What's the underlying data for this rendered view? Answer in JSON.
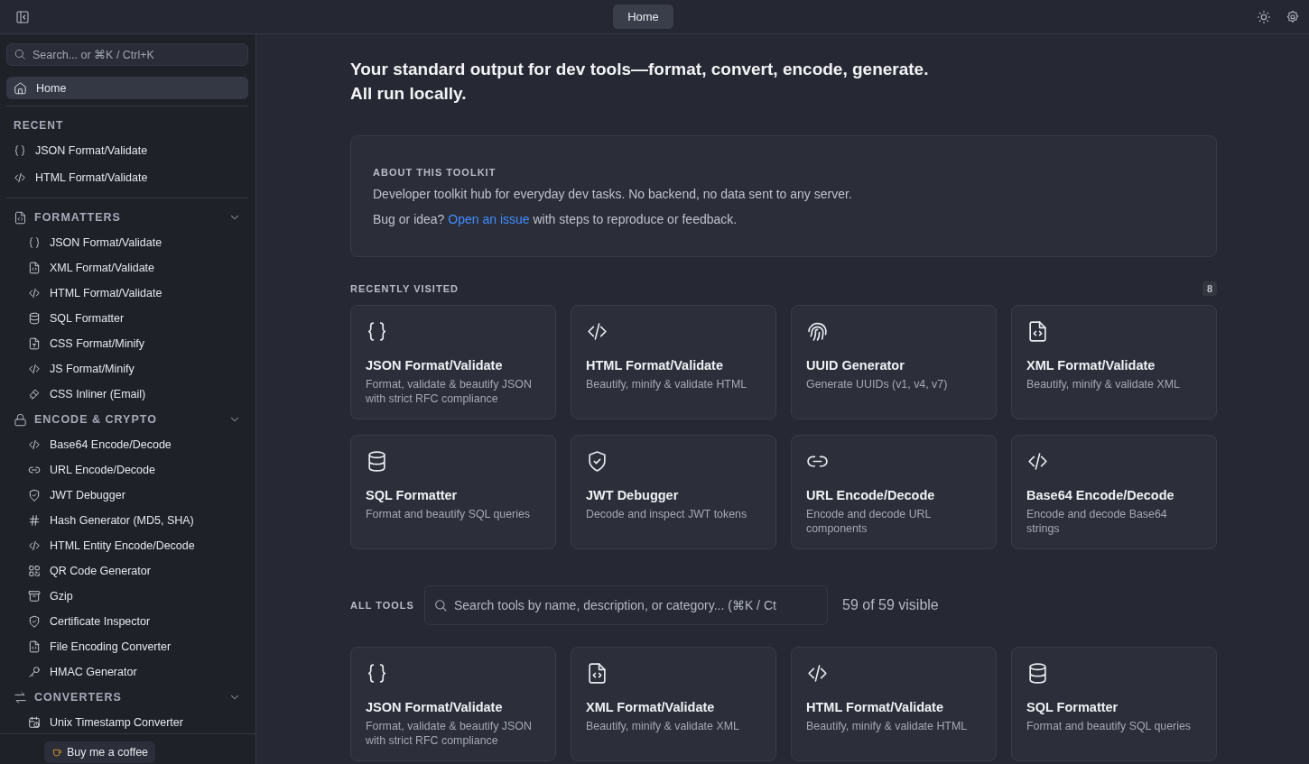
{
  "topbar": {
    "tab": {
      "label": "Home",
      "selected": true
    }
  },
  "sidebar": {
    "search": {
      "placeholder": "Search... or ⌘K / Ctrl+K"
    },
    "home": {
      "label": "Home",
      "selected": true
    },
    "recent": {
      "title": "RECENT",
      "items": [
        {
          "kind": "json",
          "label": "JSON Format/Validate",
          "selected": false
        },
        {
          "kind": "html",
          "label": "HTML Format/Validate",
          "selected": false
        }
      ]
    },
    "sections": [
      {
        "kind": "formatters",
        "title": "FORMATTERS",
        "expanded": true,
        "items": [
          {
            "kind": "json",
            "label": "JSON Format/Validate",
            "selected": false
          },
          {
            "kind": "xml",
            "label": "XML Format/Validate",
            "selected": false
          },
          {
            "kind": "html",
            "label": "HTML Format/Validate",
            "selected": false
          },
          {
            "kind": "sql",
            "label": "SQL Formatter",
            "selected": false
          },
          {
            "kind": "css",
            "label": "CSS Format/Minify",
            "selected": false
          },
          {
            "kind": "js",
            "label": "JS Format/Minify",
            "selected": false
          },
          {
            "kind": "inliner",
            "label": "CSS Inliner (Email)",
            "selected": false
          }
        ]
      },
      {
        "kind": "encode",
        "title": "ENCODE & CRYPTO",
        "expanded": true,
        "items": [
          {
            "kind": "base64",
            "label": "Base64 Encode/Decode",
            "selected": false
          },
          {
            "kind": "url",
            "label": "URL Encode/Decode",
            "selected": false
          },
          {
            "kind": "jwt",
            "label": "JWT Debugger",
            "selected": false
          },
          {
            "kind": "hash",
            "label": "Hash Generator (MD5, SHA)",
            "selected": false
          },
          {
            "kind": "entity",
            "label": "HTML Entity Encode/Decode",
            "selected": false
          },
          {
            "kind": "qr",
            "label": "QR Code Generator",
            "selected": false
          },
          {
            "kind": "gzip",
            "label": "Gzip",
            "selected": false
          },
          {
            "kind": "cert",
            "label": "Certificate Inspector",
            "selected": false
          },
          {
            "kind": "fileenc",
            "label": "File Encoding Converter",
            "selected": false
          },
          {
            "kind": "hmac",
            "label": "HMAC Generator",
            "selected": false
          }
        ]
      },
      {
        "kind": "converters",
        "title": "CONVERTERS",
        "expanded": true,
        "items": [
          {
            "kind": "timestamp",
            "label": "Unix Timestamp Converter",
            "selected": false
          }
        ]
      }
    ],
    "coffee_button": "Buy me a coffee"
  },
  "main": {
    "headline": "Your standard output for dev tools—format, convert, encode, generate. All run locally.",
    "about": {
      "title": "ABOUT THIS TOOLKIT",
      "text": "Developer toolkit hub for everyday dev tasks. No backend, no data sent to any server.",
      "bug_prefix": "Bug or idea? ",
      "bug_link": "Open an issue",
      "bug_suffix": " with steps to reproduce or feedback."
    },
    "recently_visited": {
      "title": "RECENTLY VISITED",
      "count": "8",
      "cards": [
        {
          "kind": "json",
          "title": "JSON Format/Validate",
          "description": "Format, validate & beautify JSON with strict RFC compliance"
        },
        {
          "kind": "html",
          "title": "HTML Format/Validate",
          "description": "Beautify, minify & validate HTML"
        },
        {
          "kind": "uuid",
          "title": "UUID Generator",
          "description": "Generate UUIDs (v1, v4, v7)"
        },
        {
          "kind": "xml",
          "title": "XML Format/Validate",
          "description": "Beautify, minify & validate XML"
        },
        {
          "kind": "sql",
          "title": "SQL Formatter",
          "description": "Format and beautify SQL queries"
        },
        {
          "kind": "jwt",
          "title": "JWT Debugger",
          "description": "Decode and inspect JWT tokens"
        },
        {
          "kind": "url",
          "title": "URL Encode/Decode",
          "description": "Encode and decode URL components"
        },
        {
          "kind": "base64",
          "title": "Base64 Encode/Decode",
          "description": "Encode and decode Base64 strings"
        }
      ]
    },
    "all_tools": {
      "title": "ALL TOOLS",
      "search": {
        "placeholder": "Search tools by name, description, or category... (⌘K / Ct"
      },
      "visible_count": "59 of 59 visible",
      "cards": [
        {
          "kind": "json",
          "title": "JSON Format/Validate",
          "description": "Format, validate & beautify JSON with strict RFC compliance"
        },
        {
          "kind": "xml",
          "title": "XML Format/Validate",
          "description": "Beautify, minify & validate XML"
        },
        {
          "kind": "html",
          "title": "HTML Format/Validate",
          "description": "Beautify, minify & validate HTML"
        },
        {
          "kind": "sql",
          "title": "SQL Formatter",
          "description": "Format and beautify SQL queries"
        }
      ]
    }
  }
}
